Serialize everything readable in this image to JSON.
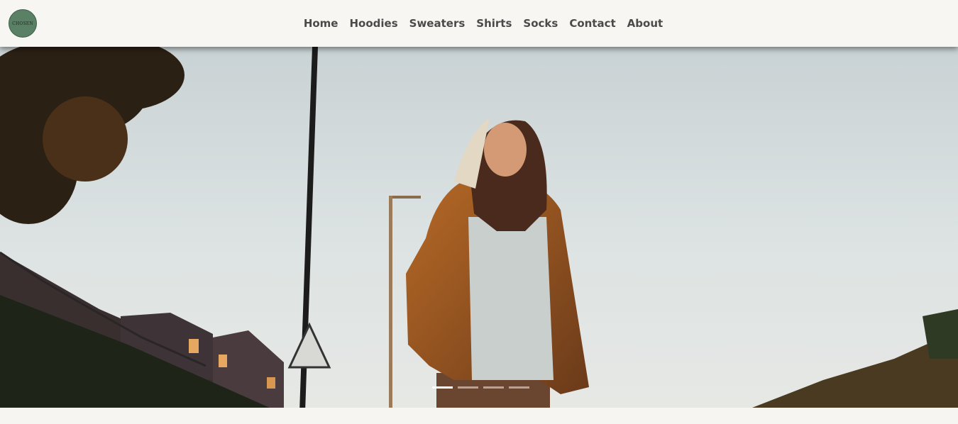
{
  "header": {
    "logo_text": "CHOSEN",
    "nav": [
      {
        "label": "Home"
      },
      {
        "label": "Hoodies"
      },
      {
        "label": "Sweaters"
      },
      {
        "label": "Shirts"
      },
      {
        "label": "Socks"
      },
      {
        "label": "Contact"
      },
      {
        "label": "About"
      }
    ]
  },
  "carousel": {
    "slide_count": 4,
    "active_index": 0
  },
  "colors": {
    "header_bg": "#f7f6f2",
    "nav_text": "#4a4a4a",
    "logo_bg": "#5a8065"
  }
}
